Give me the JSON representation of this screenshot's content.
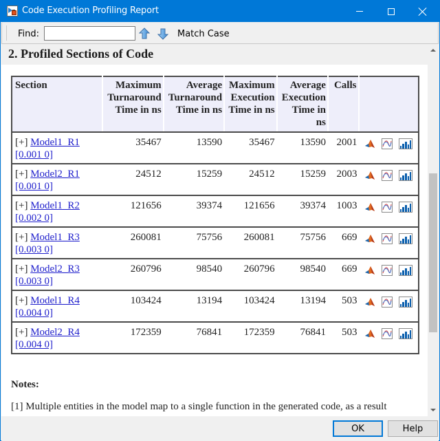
{
  "window": {
    "title": "Code Execution Profiling Report",
    "icon": "simulink-model-icon",
    "controls": [
      "minimize",
      "maximize",
      "close"
    ]
  },
  "toolbar": {
    "find_label": "Find:",
    "find_value": "",
    "find_placeholder": "",
    "find_previous_icon": "arrow-up-icon",
    "find_next_icon": "arrow-down-icon",
    "match_case_label": "Match Case"
  },
  "report": {
    "section_title": "2. Profiled Sections of Code",
    "table": {
      "headers": [
        {
          "line1": "Section",
          "line2": "",
          "line3": "",
          "line4": ""
        },
        {
          "line1": "Maximum",
          "line2": "Turnaround",
          "line3": "Time in ns",
          "line4": ""
        },
        {
          "line1": "Average",
          "line2": "Turnaround",
          "line3": "Time in ns",
          "line4": ""
        },
        {
          "line1": "Maximum",
          "line2": "Execution",
          "line3": "Time in ns",
          "line4": ""
        },
        {
          "line1": "Average",
          "line2": "Execution",
          "line3": "Time in",
          "line4": "ns"
        },
        {
          "line1": "Calls",
          "line2": "",
          "line3": "",
          "line4": ""
        },
        {
          "line1": "",
          "line2": "",
          "line3": "",
          "line4": ""
        }
      ],
      "rows": [
        {
          "expand": "[+]",
          "name": "Model1_R1",
          "rate": "[0.001 0]",
          "max_turnaround": "35467",
          "avg_turnaround": "13590",
          "max_execution": "35467",
          "avg_execution": "13590",
          "calls": "2001"
        },
        {
          "expand": "[+]",
          "name": "Model2_R1",
          "rate": "[0.001 0]",
          "max_turnaround": "24512",
          "avg_turnaround": "15259",
          "max_execution": "24512",
          "avg_execution": "15259",
          "calls": "2003"
        },
        {
          "expand": "[+]",
          "name": "Model1_R2",
          "rate": "[0.002 0]",
          "max_turnaround": "121656",
          "avg_turnaround": "39374",
          "max_execution": "121656",
          "avg_execution": "39374",
          "calls": "1003"
        },
        {
          "expand": "[+]",
          "name": "Model1_R3",
          "rate": "[0.003 0]",
          "max_turnaround": "260081",
          "avg_turnaround": "75756",
          "max_execution": "260081",
          "avg_execution": "75756",
          "calls": "669"
        },
        {
          "expand": "[+]",
          "name": "Model2_R3",
          "rate": "[0.003 0]",
          "max_turnaround": "260796",
          "avg_turnaround": "98540",
          "max_execution": "260796",
          "avg_execution": "98540",
          "calls": "669"
        },
        {
          "expand": "[+]",
          "name": "Model1_R4",
          "rate": "[0.004 0]",
          "max_turnaround": "103424",
          "avg_turnaround": "13194",
          "max_execution": "103424",
          "avg_execution": "13194",
          "calls": "503"
        },
        {
          "expand": "[+]",
          "name": "Model2_R4",
          "rate": "[0.004 0]",
          "max_turnaround": "172359",
          "avg_turnaround": "76841",
          "max_execution": "172359",
          "avg_execution": "76841",
          "calls": "503"
        }
      ],
      "row_icons": [
        "matlab-icon",
        "time-series-plot-icon",
        "histogram-icon"
      ]
    },
    "notes_title": "Notes:",
    "notes": [
      "[1] Multiple entities in the model map to a single function in the generated code, as a result"
    ]
  },
  "footer": {
    "ok_label": "OK",
    "help_label": "Help"
  },
  "colors": {
    "titlebar": "#0078d7",
    "header_bg": "#eeeefa",
    "link": "#2020cc",
    "table_border": "#4a4a4a"
  }
}
